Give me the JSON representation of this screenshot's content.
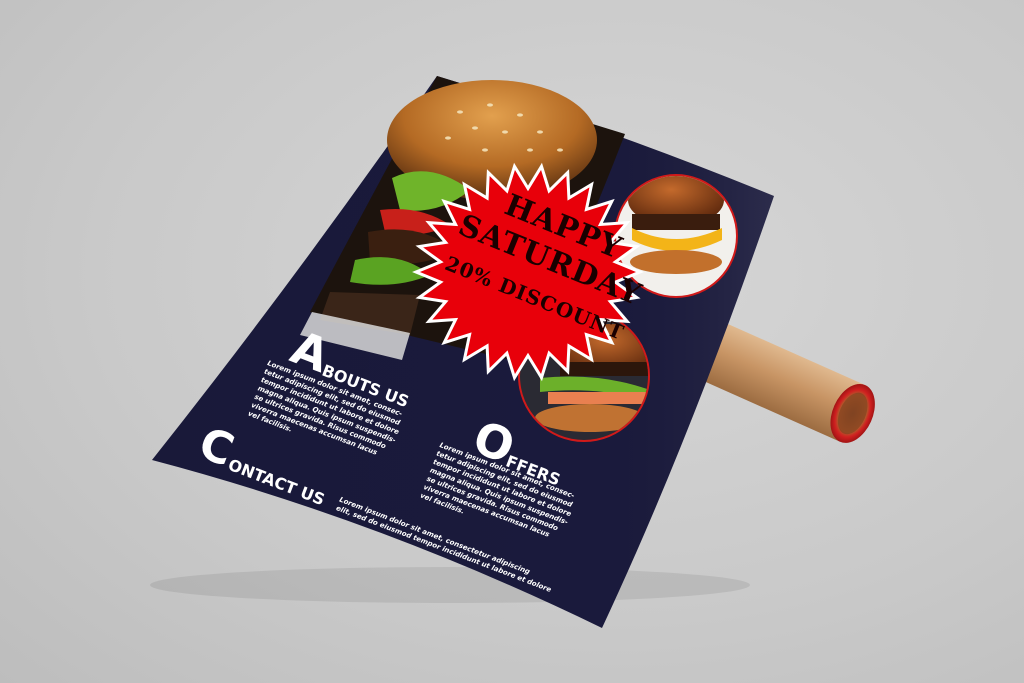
{
  "flyer": {
    "promo": {
      "line1": "HAPPY",
      "line2": "SATURDAY",
      "line3": "20% DISCOUNT"
    },
    "about": {
      "initial": "A",
      "rest": "BOUTS US",
      "text": [
        "Lorem ipsum dolor sit amet, consec-",
        "tetur adipiscing elit, sed do eiusmod",
        "tempor incididunt ut labore et dolore",
        "magna aliqua. Quis ipsum suspendis-",
        "se ultrices gravida. Risus commodo",
        "viverra maecenas accumsan lacus",
        "vel facilisis."
      ]
    },
    "contact": {
      "initial": "C",
      "rest": "ONTACT US",
      "text": [
        "Lorem ipsum dolor sit amet, consectetur adipiscing",
        "elit, sed do eiusmod tempor incididunt ut labore et dolore"
      ]
    },
    "offers": {
      "initial": "O",
      "rest": "FFERS",
      "text": [
        "Lorem ipsum dolor sit amet, consec-",
        "tetur adipiscing elit, sed do eiusmod",
        "tempor incididunt ut labore et dolore",
        "magna aliqua. Quis ipsum suspendis-",
        "se ultrices gravida. Risus commodo",
        "viverra maecenas accumsan lacus",
        "vel facilisis."
      ]
    }
  },
  "colors": {
    "flyer_background": "#1a1a3c",
    "promo_red": "#e8000a",
    "circle_border": "#d11a1a",
    "tube": "#c99b6b",
    "tube_cap": "#cc1f1f"
  }
}
